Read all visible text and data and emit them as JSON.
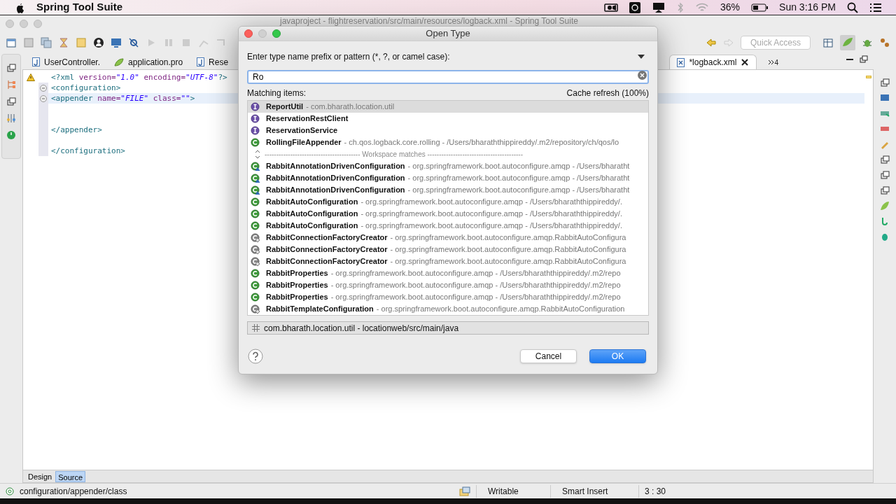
{
  "menubar": {
    "app_name": "Spring Tool Suite",
    "battery": "36%",
    "clock": "Sun 3:16 PM"
  },
  "window": {
    "title": "javaproject - flightreservation/src/main/resources/logback.xml - Spring Tool Suite"
  },
  "toolbar": {
    "quick_access": {
      "placeholder": "Quick Access"
    }
  },
  "editor_tabs": [
    {
      "label": "UserController.",
      "kind": "java",
      "selected": false
    },
    {
      "label": "application.pro",
      "kind": "properties",
      "selected": false
    },
    {
      "label": "Rese",
      "kind": "java",
      "selected": false
    },
    {
      "label": "*logback.xml",
      "kind": "xml",
      "selected": true
    }
  ],
  "tab_overflow": "4",
  "code_lines": [
    {
      "warning": true,
      "fold": false,
      "current": false,
      "tokens": [
        {
          "kind": "tag",
          "text": "<?xml "
        },
        {
          "kind": "attr",
          "text": "version="
        },
        {
          "kind": "value",
          "text": "\"1.0\" "
        },
        {
          "kind": "attr",
          "text": "encoding="
        },
        {
          "kind": "value",
          "text": "\"UTF-8\""
        },
        {
          "kind": "tag",
          "text": "?>"
        }
      ]
    },
    {
      "warning": false,
      "fold": true,
      "current": false,
      "tokens": [
        {
          "kind": "tag",
          "text": "<configuration>"
        }
      ]
    },
    {
      "warning": false,
      "fold": true,
      "current": true,
      "tokens": [
        {
          "kind": "tag",
          "text": "<appender "
        },
        {
          "kind": "attr",
          "text": "name="
        },
        {
          "kind": "value",
          "text": "\"FILE\" "
        },
        {
          "kind": "attr",
          "text": "class="
        },
        {
          "kind": "value",
          "text": "\"\""
        },
        {
          "kind": "tag",
          "text": ">"
        }
      ]
    },
    {
      "blank": true
    },
    {
      "blank": true
    },
    {
      "warning": false,
      "fold": false,
      "current": false,
      "tokens": [
        {
          "kind": "tag",
          "text": "</appender>"
        }
      ]
    },
    {
      "blank": true
    },
    {
      "warning": false,
      "fold": false,
      "current": false,
      "tokens": [
        {
          "kind": "tag",
          "text": "</configuration>"
        }
      ]
    }
  ],
  "editor_mode_tabs": [
    {
      "label": "Design",
      "selected": false
    },
    {
      "label": "Source",
      "selected": true
    }
  ],
  "status_bar": {
    "path": "configuration/appender/class",
    "writable": "Writable",
    "insert_mode": "Smart Insert",
    "position": "3 : 30"
  },
  "dialog": {
    "title": "Open Type",
    "prompt": "Enter type name prefix or pattern (*, ?, or camel case):",
    "search": {
      "value": "Ro"
    },
    "matching_label": "Matching items:",
    "cache_status": "Cache refresh (100%)",
    "items": [
      {
        "kind": "interface",
        "name": "ReportUtil",
        "detail": "- com.bharath.location.util",
        "selected": true
      },
      {
        "kind": "interface",
        "name": "ReservationRestClient",
        "selected": false
      },
      {
        "kind": "interface",
        "name": "ReservationService",
        "selected": false
      },
      {
        "kind": "class",
        "name": "RollingFileAppender",
        "detail": "- ch.qos.logback.core.rolling - /Users/bharaththippireddy/.m2/repository/ch/qos/lo",
        "selected": false
      },
      {
        "kind": "separator",
        "name": "----------------------------------------- Workspace matches -----------------------------------------"
      },
      {
        "kind": "class_linked",
        "name": "RabbitAnnotationDrivenConfiguration",
        "detail": "- org.springframework.boot.autoconfigure.amqp - /Users/bharatht",
        "selected": false
      },
      {
        "kind": "class_linked",
        "name": "RabbitAnnotationDrivenConfiguration",
        "detail": "- org.springframework.boot.autoconfigure.amqp - /Users/bharatht",
        "selected": false
      },
      {
        "kind": "class_linked",
        "name": "RabbitAnnotationDrivenConfiguration",
        "detail": "- org.springframework.boot.autoconfigure.amqp - /Users/bharatht",
        "selected": false
      },
      {
        "kind": "class",
        "name": "RabbitAutoConfiguration",
        "detail": "- org.springframework.boot.autoconfigure.amqp - /Users/bharaththippireddy/.",
        "selected": false
      },
      {
        "kind": "class",
        "name": "RabbitAutoConfiguration",
        "detail": "- org.springframework.boot.autoconfigure.amqp - /Users/bharaththippireddy/.",
        "selected": false
      },
      {
        "kind": "class",
        "name": "RabbitAutoConfiguration",
        "detail": "- org.springframework.boot.autoconfigure.amqp - /Users/bharaththippireddy/.",
        "selected": false
      },
      {
        "kind": "inner_static",
        "name": "RabbitConnectionFactoryCreator",
        "detail": "- org.springframework.boot.autoconfigure.amqp.RabbitAutoConfigura",
        "selected": false
      },
      {
        "kind": "inner_static",
        "name": "RabbitConnectionFactoryCreator",
        "detail": "- org.springframework.boot.autoconfigure.amqp.RabbitAutoConfigura",
        "selected": false
      },
      {
        "kind": "inner_static",
        "name": "RabbitConnectionFactoryCreator",
        "detail": "- org.springframework.boot.autoconfigure.amqp.RabbitAutoConfigura",
        "selected": false
      },
      {
        "kind": "class",
        "name": "RabbitProperties",
        "detail": "- org.springframework.boot.autoconfigure.amqp - /Users/bharaththippireddy/.m2/repo",
        "selected": false
      },
      {
        "kind": "class",
        "name": "RabbitProperties",
        "detail": "- org.springframework.boot.autoconfigure.amqp - /Users/bharaththippireddy/.m2/repo",
        "selected": false
      },
      {
        "kind": "class",
        "name": "RabbitProperties",
        "detail": "- org.springframework.boot.autoconfigure.amqp - /Users/bharaththippireddy/.m2/repo",
        "selected": false
      },
      {
        "kind": "inner_static",
        "name": "RabbitTemplateConfiguration",
        "detail": "- org.springframework.boot.autoconfigure.amqp.RabbitAutoConfiguration",
        "selected": false
      }
    ],
    "location": "com.bharath.location.util - locationweb/src/main/java",
    "buttons": [
      {
        "label": "Cancel",
        "kind": "secondary"
      },
      {
        "label": "OK",
        "kind": "primary"
      }
    ]
  }
}
